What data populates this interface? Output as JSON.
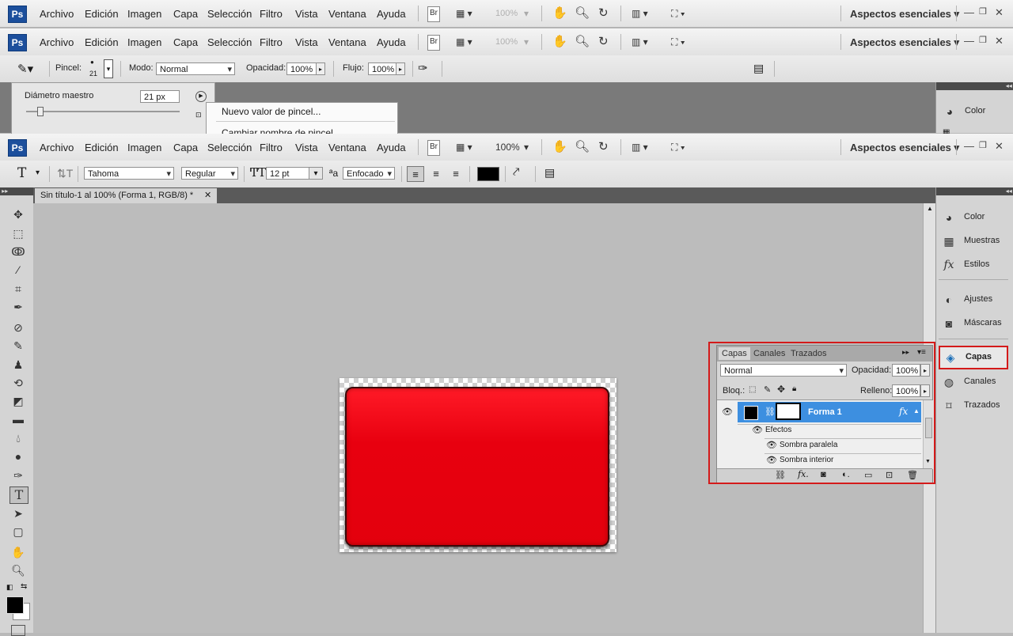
{
  "app_logo": "Ps",
  "menu": [
    "Archivo",
    "Edición",
    "Imagen",
    "Capa",
    "Selección",
    "Filtro",
    "Vista",
    "Ventana",
    "Ayuda"
  ],
  "menubar": {
    "bridge": "Br",
    "zoom_disabled": "100%",
    "zoom": "100%",
    "workspace": "Aspectos esenciales ▾"
  },
  "brush_options": {
    "pincel_label": "Pincel:",
    "brush_size": "21",
    "modo_label": "Modo:",
    "modo_value": "Normal",
    "opacidad_label": "Opacidad:",
    "opacidad_value": "100%",
    "flujo_label": "Flujo:",
    "flujo_value": "100%"
  },
  "brush_picker": {
    "diameter_label": "Diámetro maestro",
    "diameter_value": "21 px"
  },
  "context_menu": [
    "Nuevo valor de pincel...",
    "Cambiar nombre de pincel..."
  ],
  "type_options": {
    "font": "Tahoma",
    "style": "Regular",
    "size": "12 pt",
    "aa_prefix": "a",
    "antialias": "Enfocado",
    "color": "#000000"
  },
  "document": {
    "tab_title": "Sin título-1 al 100% (Forma 1, RGB/8) *",
    "close": "✕",
    "shape_color": "#e60012"
  },
  "right_panel_top": [
    {
      "icon": "color-icon",
      "label": "Color"
    }
  ],
  "right_panel": [
    {
      "icon": "color-icon",
      "label": "Color"
    },
    {
      "icon": "swatches-icon",
      "label": "Muestras"
    },
    {
      "icon": "styles-icon",
      "label": "Estilos"
    },
    {
      "icon": "adjustments-icon",
      "label": "Ajustes"
    },
    {
      "icon": "masks-icon",
      "label": "Máscaras"
    },
    {
      "icon": "layers-icon",
      "label": "Capas"
    },
    {
      "icon": "channels-icon",
      "label": "Canales"
    },
    {
      "icon": "paths-icon",
      "label": "Trazados"
    }
  ],
  "layers_panel": {
    "tabs": [
      "Capas",
      "Canales",
      "Trazados"
    ],
    "blend_mode": "Normal",
    "opacity_label": "Opacidad:",
    "opacity_value": "100%",
    "lock_label": "Bloq.:",
    "fill_label": "Relleno:",
    "fill_value": "100%",
    "layer_name": "Forma 1",
    "fx": "fx",
    "effects_label": "Efectos",
    "effects": [
      "Sombra paralela",
      "Sombra interior"
    ],
    "highlight_color": "#3d8fe0",
    "outline_color": "#d41a1a"
  }
}
